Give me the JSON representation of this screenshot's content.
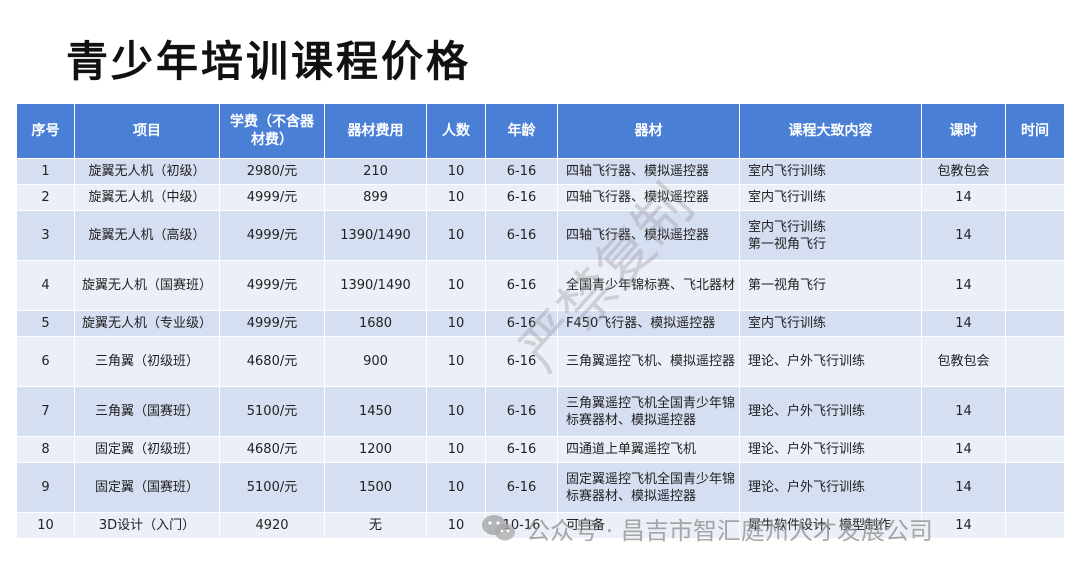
{
  "page_title": "青少年培训课程价格",
  "table": {
    "headers": [
      "序号",
      "项目",
      "学费（不含器材费）",
      "器材费用",
      "人数",
      "年龄",
      "器材",
      "课程大致内容",
      "课时",
      "时间"
    ],
    "rows": [
      {
        "no": "1",
        "item": "旋翼无人机（初级）",
        "fee": "2980/元",
        "equip_fee": "210",
        "people": "10",
        "age": "6-16",
        "equipment": "四轴飞行器、模拟遥控器",
        "content": "室内飞行训练",
        "hours": "包教包会",
        "time": ""
      },
      {
        "no": "2",
        "item": "旋翼无人机（中级）",
        "fee": "4999/元",
        "equip_fee": "899",
        "people": "10",
        "age": "6-16",
        "equipment": "四轴飞行器、模拟遥控器",
        "content": "室内飞行训练",
        "hours": "14",
        "time": ""
      },
      {
        "no": "3",
        "item": "旋翼无人机（高级）",
        "fee": "4999/元",
        "equip_fee": "1390/1490",
        "people": "10",
        "age": "6-16",
        "equipment": "四轴飞行器、模拟遥控器",
        "content": "室内飞行训练\n第一视角飞行",
        "hours": "14",
        "time": ""
      },
      {
        "no": "4",
        "item": "旋翼无人机（国赛班）",
        "fee": "4999/元",
        "equip_fee": "1390/1490",
        "people": "10",
        "age": "6-16",
        "equipment": "全国青少年锦标赛、飞北器材",
        "content": "第一视角飞行",
        "hours": "14",
        "time": ""
      },
      {
        "no": "5",
        "item": "旋翼无人机（专业级）",
        "fee": "4999/元",
        "equip_fee": "1680",
        "people": "10",
        "age": "6-16",
        "equipment": "F450飞行器、模拟遥控器",
        "content": "室内飞行训练",
        "hours": "14",
        "time": ""
      },
      {
        "no": "6",
        "item": "三角翼（初级班）",
        "fee": "4680/元",
        "equip_fee": "900",
        "people": "10",
        "age": "6-16",
        "equipment": "三角翼遥控飞机、模拟遥控器",
        "content": "理论、户外飞行训练",
        "hours": "包教包会",
        "time": ""
      },
      {
        "no": "7",
        "item": "三角翼（国赛班）",
        "fee": "5100/元",
        "equip_fee": "1450",
        "people": "10",
        "age": "6-16",
        "equipment": "三角翼遥控飞机全国青少年锦标赛器材、模拟遥控器",
        "content": "理论、户外飞行训练",
        "hours": "14",
        "time": ""
      },
      {
        "no": "8",
        "item": "固定翼（初级班）",
        "fee": "4680/元",
        "equip_fee": "1200",
        "people": "10",
        "age": "6-16",
        "equipment": "四通道上单翼遥控飞机",
        "content": "理论、户外飞行训练",
        "hours": "14",
        "time": ""
      },
      {
        "no": "9",
        "item": "固定翼（国赛班）",
        "fee": "5100/元",
        "equip_fee": "1500",
        "people": "10",
        "age": "6-16",
        "equipment": "固定翼遥控飞机全国青少年锦标赛器材、模拟遥控器",
        "content": "理论、户外飞行训练",
        "hours": "14",
        "time": ""
      },
      {
        "no": "10",
        "item": "3D设计（入门）",
        "fee": "4920",
        "equip_fee": "无",
        "people": "10",
        "age": "10-16",
        "equipment": "可自备",
        "content": "犀牛软件设计、模型制作",
        "hours": "14",
        "time": ""
      }
    ]
  },
  "watermark_text": "严禁复制",
  "footer_watermark": "公众号 · 昌吉市智汇庭州人才发展公司",
  "colors": {
    "header_bg": "#4a7fd6",
    "row_odd": "#d6def2",
    "row_even": "#ebeff8"
  },
  "icons": {
    "footer": "wechat-icon"
  }
}
